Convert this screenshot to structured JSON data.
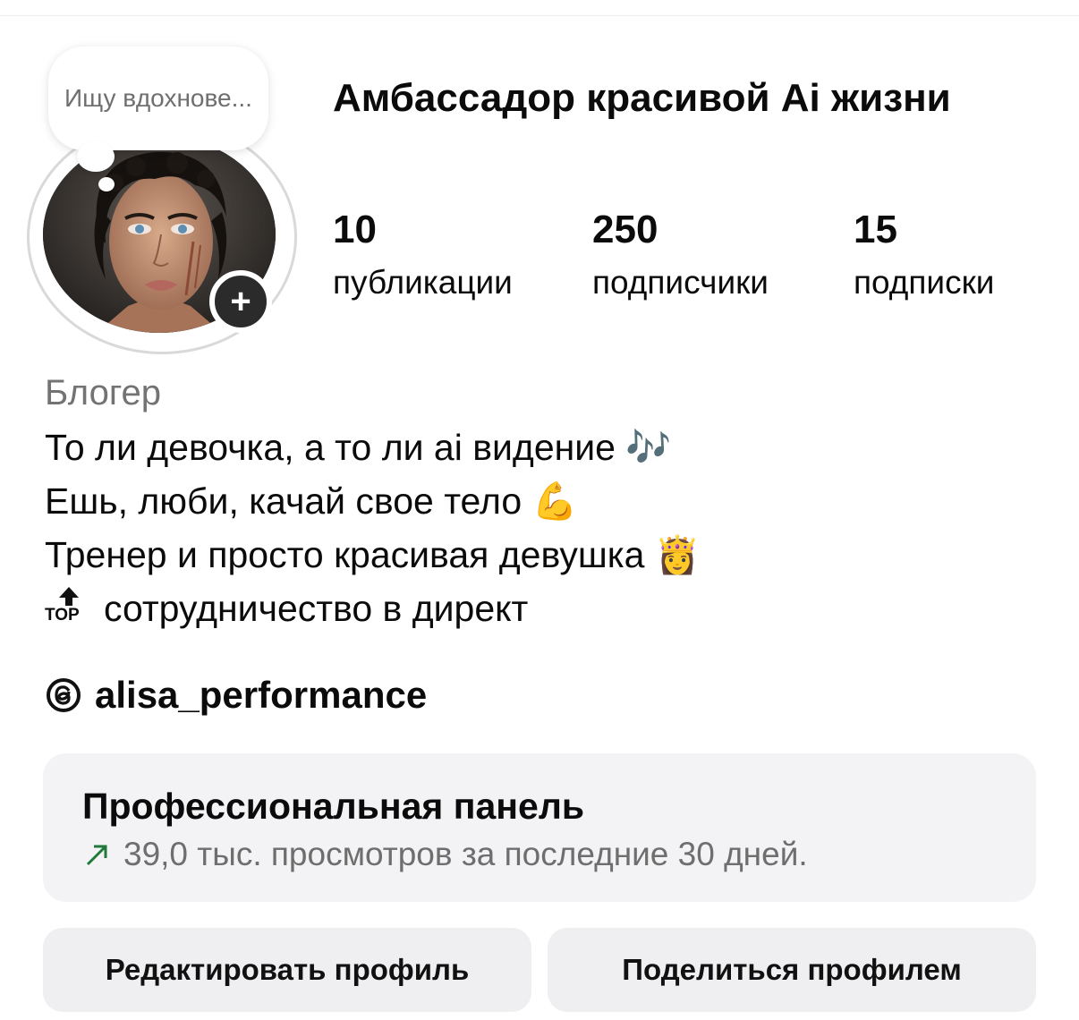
{
  "profile": {
    "note": "Ищу вдохнове...",
    "name": "Амбассадор красивой Ai жизни",
    "stats": [
      {
        "value": "10",
        "label": "публикации"
      },
      {
        "value": "250",
        "label": "подписчики"
      },
      {
        "value": "15",
        "label": "подписки"
      }
    ]
  },
  "bio": {
    "category": "Блогер",
    "lines": [
      {
        "text": "То ли девочка, а то ли ai видение",
        "emoji": "🎶",
        "emoji_icon": "musical-notes-icon"
      },
      {
        "text": "Ешь, люби, качай свое тело",
        "emoji": "💪",
        "emoji_icon": "flexed-biceps-icon"
      },
      {
        "text": "Тренер и просто красивая девушка",
        "emoji": "👸",
        "emoji_icon": "princess-icon"
      },
      {
        "text": "сотрудничество в директ",
        "prefix_icon": "top-arrow-icon",
        "prefix_text": "TOP"
      }
    ]
  },
  "threads": {
    "icon": "threads-icon",
    "handle": "alisa_performance"
  },
  "pro_panel": {
    "title": "Профессиональная панель",
    "trend_icon": "trend-up-arrow-icon",
    "trend_color": "#1f7a3a",
    "subtitle": "39,0 тыс. просмотров за последние 30 дней."
  },
  "buttons": {
    "edit": "Редактировать профиль",
    "share": "Поделиться профилем"
  },
  "colors": {
    "background": "#ffffff",
    "panel_background": "#f3f3f5",
    "button_background": "#efeff1",
    "secondary_text": "#737373",
    "add_button": "#2b2b2b"
  }
}
